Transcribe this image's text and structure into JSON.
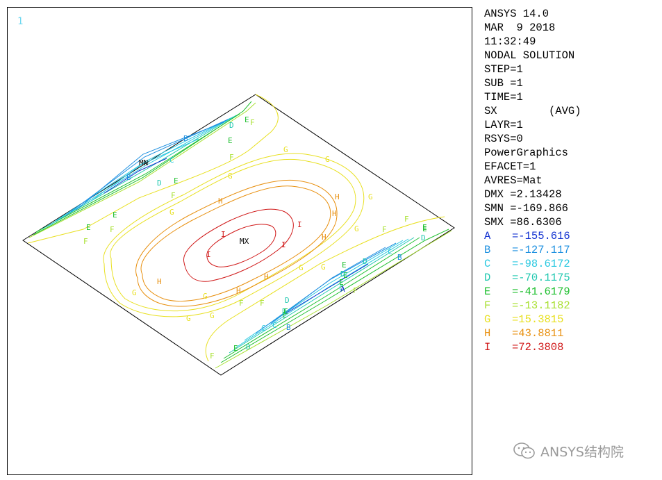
{
  "window_number": "1",
  "info_lines": [
    "ANSYS 14.0",
    "MAR  9 2018",
    "11:32:49",
    "NODAL SOLUTION",
    "STEP=1",
    "SUB =1",
    "TIME=1",
    "SX        (AVG)",
    "LAYR=1",
    "RSYS=0",
    "PowerGraphics",
    "EFACET=1",
    "AVRES=Mat",
    "DMX =2.13428",
    "SMN =-169.866",
    "SMX =86.6306"
  ],
  "legend": [
    {
      "letter": "A",
      "value": "=-155.616",
      "color": "#1030d0"
    },
    {
      "letter": "B",
      "value": "=-127.117",
      "color": "#1e90e0"
    },
    {
      "letter": "C",
      "value": "=-98.6172",
      "color": "#28c8e0"
    },
    {
      "letter": "D",
      "value": "=-70.1175",
      "color": "#20c8b0"
    },
    {
      "letter": "E",
      "value": "=-41.6179",
      "color": "#20c030"
    },
    {
      "letter": "F",
      "value": "=-13.1182",
      "color": "#a8e030"
    },
    {
      "letter": "G",
      "value": "=15.3815",
      "color": "#e8e020"
    },
    {
      "letter": "H",
      "value": "=43.8811",
      "color": "#e89010"
    },
    {
      "letter": "I",
      "value": "=72.3808",
      "color": "#d01818"
    }
  ],
  "plot": {
    "min_marker": "MN",
    "max_marker": "MX"
  },
  "contour_labels": [
    {
      "t": "E",
      "c": "#20c030"
    },
    {
      "t": "D",
      "c": "#20c8b0"
    },
    {
      "t": "E",
      "c": "#20c030"
    },
    {
      "t": "B",
      "c": "#1e90e0"
    },
    {
      "t": "C",
      "c": "#28c8e0"
    },
    {
      "t": "D",
      "c": "#20c8b0"
    },
    {
      "t": "E",
      "c": "#20c030"
    },
    {
      "t": "B",
      "c": "#1e90e0"
    },
    {
      "t": "F",
      "c": "#a8e030"
    },
    {
      "t": "F",
      "c": "#a8e030"
    },
    {
      "t": "E",
      "c": "#20c030"
    },
    {
      "t": "E",
      "c": "#20c030"
    },
    {
      "t": "F",
      "c": "#a8e030"
    },
    {
      "t": "F",
      "c": "#a8e030"
    },
    {
      "t": "G",
      "c": "#e8e020"
    },
    {
      "t": "G",
      "c": "#e8e020"
    },
    {
      "t": "G",
      "c": "#e8e020"
    },
    {
      "t": "G",
      "c": "#e8e020"
    },
    {
      "t": "H",
      "c": "#e89010"
    },
    {
      "t": "H",
      "c": "#e89010"
    },
    {
      "t": "H",
      "c": "#e89010"
    },
    {
      "t": "I",
      "c": "#d01818"
    },
    {
      "t": "I",
      "c": "#d01818"
    },
    {
      "t": "I",
      "c": "#d01818"
    },
    {
      "t": "I",
      "c": "#d01818"
    },
    {
      "t": "H",
      "c": "#e89010"
    },
    {
      "t": "G",
      "c": "#e8e020"
    },
    {
      "t": "H",
      "c": "#e89010"
    },
    {
      "t": "H",
      "c": "#e89010"
    },
    {
      "t": "H",
      "c": "#e89010"
    },
    {
      "t": "G",
      "c": "#e8e020"
    },
    {
      "t": "G",
      "c": "#e8e020"
    },
    {
      "t": "G",
      "c": "#e8e020"
    },
    {
      "t": "G",
      "c": "#e8e020"
    },
    {
      "t": "G",
      "c": "#e8e020"
    },
    {
      "t": "G",
      "c": "#e8e020"
    },
    {
      "t": "G",
      "c": "#e8e020"
    },
    {
      "t": "F",
      "c": "#a8e030"
    },
    {
      "t": "F",
      "c": "#a8e030"
    },
    {
      "t": "F",
      "c": "#a8e030"
    },
    {
      "t": "E",
      "c": "#20c030"
    },
    {
      "t": "F",
      "c": "#a8e030"
    },
    {
      "t": "E",
      "c": "#20c030"
    },
    {
      "t": "D",
      "c": "#20c8b0"
    },
    {
      "t": "E",
      "c": "#20c030"
    },
    {
      "t": "C",
      "c": "#28c8e0"
    },
    {
      "t": "D",
      "c": "#20c8b0"
    },
    {
      "t": "D",
      "c": "#20c8b0"
    },
    {
      "t": "E",
      "c": "#20c030"
    },
    {
      "t": "E",
      "c": "#20c030"
    },
    {
      "t": "F",
      "c": "#a8e030"
    },
    {
      "t": "C",
      "c": "#28c8e0"
    },
    {
      "t": "A",
      "c": "#1030d0"
    },
    {
      "t": "B",
      "c": "#1e90e0"
    },
    {
      "t": "D",
      "c": "#20c8b0"
    },
    {
      "t": "E",
      "c": "#20c030"
    },
    {
      "t": "E",
      "c": "#20c030"
    },
    {
      "t": "D",
      "c": "#20c8b0"
    },
    {
      "t": "C",
      "c": "#28c8e0"
    },
    {
      "t": "B",
      "c": "#1e90e0"
    },
    {
      "t": "C",
      "c": "#28c8e0"
    },
    {
      "t": "F",
      "c": "#a8e030"
    },
    {
      "t": "E",
      "c": "#20c030"
    },
    {
      "t": "D",
      "c": "#20c8b0"
    },
    {
      "t": "F",
      "c": "#a8e030"
    }
  ],
  "watermark": {
    "text": "ANSYS结构院",
    "icon": "wechat-icon"
  }
}
